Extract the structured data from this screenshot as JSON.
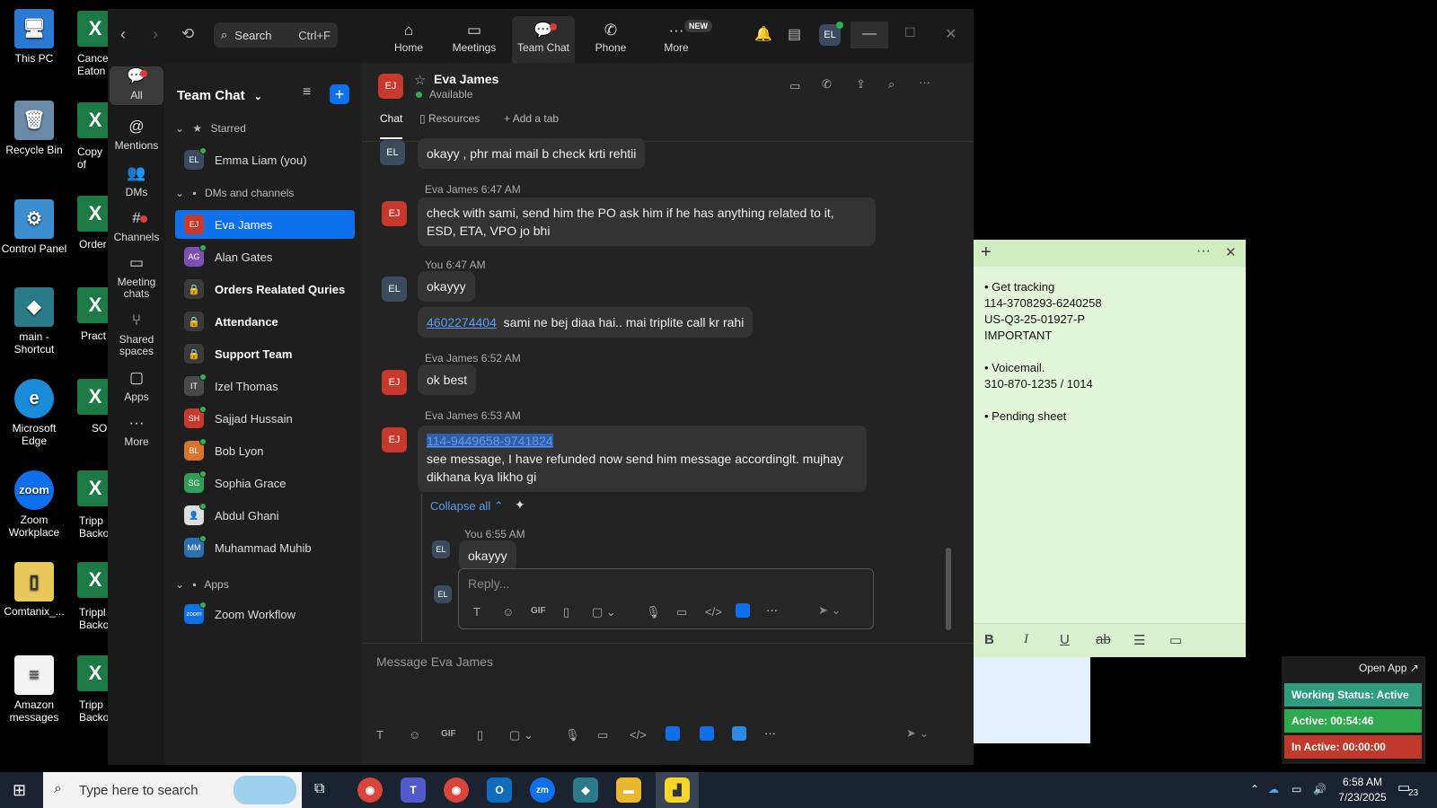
{
  "desktop": {
    "icons": [
      {
        "label": "This PC",
        "glyph": "🖥"
      },
      {
        "label": "Recycle Bin",
        "glyph": "🗑"
      },
      {
        "label": "Control Panel",
        "glyph": "⚙"
      },
      {
        "label": "main - Shortcut",
        "glyph": "◆"
      },
      {
        "label": "Microsoft Edge",
        "glyph": "e"
      },
      {
        "label": "Zoom Workplace",
        "glyph": "zoom"
      },
      {
        "label": "Comtanix_...",
        "glyph": "▯"
      },
      {
        "label": "Amazon messages",
        "glyph": "≡"
      }
    ],
    "excel_labels": [
      "Cance Eaton",
      "Copy of Logins",
      "Order",
      "Pract",
      "SO",
      "Tripp Backor",
      "Trippl Backor",
      "Tripp Backor"
    ]
  },
  "topbar": {
    "search_label": "Search",
    "search_shortcut": "Ctrl+F",
    "nav": [
      "Home",
      "Meetings",
      "Team Chat",
      "Phone",
      "More"
    ],
    "more_badge": "NEW",
    "avatar_initials": "EL"
  },
  "rail": {
    "items": [
      "All",
      "Mentions",
      "DMs",
      "Channels",
      "Meeting chats",
      "Shared spaces",
      "Apps",
      "More"
    ]
  },
  "chatlist": {
    "title": "Team Chat",
    "starred_label": "Starred",
    "starred": [
      {
        "initials": "EL",
        "name": "Emma Liam (you)",
        "color": "#3c4a5e"
      }
    ],
    "dms_label": "DMs and channels",
    "dms": [
      {
        "initials": "EJ",
        "name": "Eva James",
        "color": "#c8392b"
      },
      {
        "initials": "AG",
        "name": "Alan Gates",
        "color": "#7b4fb3"
      },
      {
        "initials": "",
        "name": "Orders Realated Quries",
        "color": ""
      },
      {
        "initials": "",
        "name": "Attendance",
        "color": ""
      },
      {
        "initials": "",
        "name": "Support Team",
        "color": ""
      },
      {
        "initials": "IT",
        "name": "Izel Thomas",
        "color": "#4a4a4a"
      },
      {
        "initials": "SH",
        "name": "Sajjad Hussain",
        "color": "#c8392b"
      },
      {
        "initials": "BL",
        "name": "Bob Lyon",
        "color": "#d9742b"
      },
      {
        "initials": "SG",
        "name": "Sophia Grace",
        "color": "#2f9e5a"
      },
      {
        "initials": "",
        "name": "Abdul Ghani",
        "color": "#ddd"
      },
      {
        "initials": "MM",
        "name": "Muhammad Muhib",
        "color": "#2b6fb3"
      }
    ],
    "apps_label": "Apps",
    "apps": [
      {
        "initials": "zoom",
        "name": "Zoom Workflow",
        "color": "#0e71eb"
      }
    ]
  },
  "chat": {
    "contact_name": "Eva James",
    "contact_status": "Available",
    "contact_initials": "EJ",
    "tabs": [
      "Chat",
      "Resources",
      "Add a tab"
    ],
    "messages": {
      "m0_text": "okayy , phr mai mail b check krti rehtii",
      "m1_meta": "Eva James 6:47 AM",
      "m1_text_a": "check with sami, send him the PO ask him if he has anything related to it,",
      "m1_text_b": "ESD, ETA, VPO jo bhi",
      "m2_meta": "You 6:47 AM",
      "m2_text": "okayyy",
      "m3_link": "4602274404",
      "m3_text": "sami ne bej diaa hai.. mai triplite call kr rahi",
      "m4_meta": "Eva James 6:52 AM",
      "m4_text": "ok best",
      "m5_meta": "Eva James 6:53 AM",
      "m5_link": "114-9449658-9741824",
      "m5_text_a": "see message, I have refunded now send him message accordinglt. mujhay",
      "m5_text_b": "dikhana kya likho gi",
      "collapse": "Collapse all",
      "r1_meta": "You 6:55 AM",
      "r1_text": "okayyy"
    },
    "reply_placeholder": "Reply...",
    "input_placeholder": "Message Eva James",
    "you_initials": "EL"
  },
  "sticky": {
    "lines": [
      "• Get tracking",
      "114-3708293-6240258",
      "US-Q3-25-01927-P",
      "IMPORTANT",
      "",
      "• Voicemail.",
      "310-870-1235 / 1014",
      "",
      "• Pending sheet"
    ]
  },
  "status": {
    "open_app": "Open App ↗",
    "working": "Working Status: Active",
    "active": "Active: 00:54:46",
    "inactive": "In Active: 00:00:00",
    "colors": {
      "working": "#2e9e7e",
      "active": "#2fa84f",
      "inactive": "#c0392b"
    }
  },
  "taskbar": {
    "search_placeholder": "Type here to search",
    "time": "6:58 AM",
    "date": "7/23/2025",
    "notif_count": "23"
  }
}
